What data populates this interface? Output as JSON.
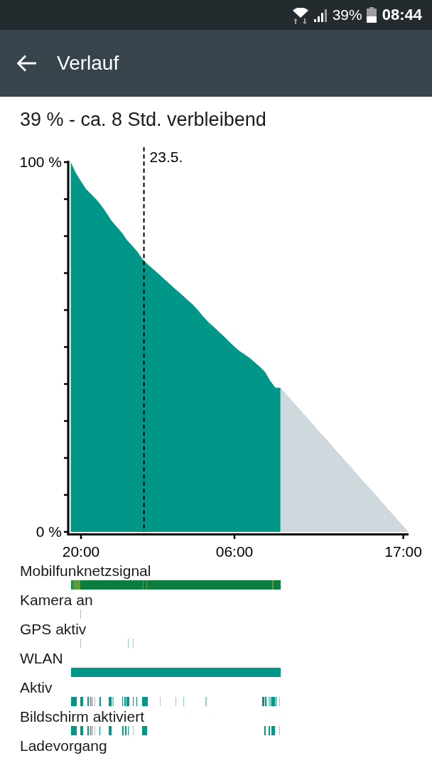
{
  "status_bar": {
    "battery_percent": "39%",
    "time": "08:44"
  },
  "app_bar": {
    "title": "Verlauf"
  },
  "summary": "39 % - ca. 8 Std. verbleibend",
  "battery_chart": {
    "chart_data": {
      "type": "area",
      "categories": [
        null,
        null,
        "20:00",
        null,
        null,
        null,
        null,
        null,
        null,
        null,
        null,
        null,
        null,
        null,
        null,
        null,
        null,
        null,
        null,
        null,
        null,
        null,
        null,
        null,
        null,
        null,
        null,
        null,
        null,
        null,
        null,
        null,
        "06:00",
        null,
        null,
        null,
        null,
        null,
        null,
        null,
        null,
        null,
        null,
        null,
        null,
        null,
        null,
        null,
        null,
        null,
        null,
        null,
        null,
        null,
        null,
        null,
        null,
        null,
        null,
        null,
        null,
        null,
        null,
        null,
        null,
        "17:00",
        null
      ],
      "series": [
        {
          "color": "#009688",
          "values": [
            100,
            97,
            94.8,
            92.7,
            91.3,
            89.9,
            88.2,
            86.2,
            84.1,
            82.5,
            80.9,
            78.9,
            77.4,
            75.8,
            73.8,
            72.4,
            71.2,
            70,
            68.7,
            67.5,
            66.2,
            65,
            63.8,
            62.5,
            61.3,
            59.7,
            58.1,
            56.6,
            55.4,
            54.1,
            52.8,
            51.4,
            50.1,
            48.9,
            48,
            47,
            45.8,
            44.6,
            43.2,
            40.8,
            39,
            39,
            null,
            null,
            null,
            null,
            null,
            null,
            null,
            null,
            null,
            null,
            null,
            null,
            null,
            null,
            null,
            null,
            null,
            null,
            null,
            null,
            null,
            null,
            null,
            null,
            null
          ]
        },
        {
          "color": "#cfd8dc",
          "values": [
            null,
            null,
            null,
            null,
            null,
            null,
            null,
            null,
            null,
            null,
            null,
            null,
            null,
            null,
            null,
            null,
            null,
            null,
            null,
            null,
            null,
            null,
            null,
            null,
            null,
            null,
            null,
            null,
            null,
            null,
            null,
            null,
            null,
            null,
            null,
            null,
            null,
            null,
            null,
            null,
            null,
            39,
            37.4,
            35.9,
            34.3,
            32.8,
            31.2,
            29.6,
            28.1,
            26.5,
            25,
            23.4,
            21.8,
            20.3,
            18.7,
            17.2,
            15.6,
            14,
            12.5,
            10.9,
            9.4,
            7.8,
            6.2,
            4.7,
            3.1,
            1.6,
            0
          ]
        }
      ],
      "ylim": [
        0,
        100
      ],
      "yticks": [
        {
          "value": 0,
          "label": "0 %"
        },
        {
          "value": 100,
          "label": "100 %"
        }
      ],
      "annotations": [
        "23.5."
      ]
    }
  },
  "usage_rows": [
    {
      "label": "Mobilfunknetzsignal",
      "kind": "signal"
    },
    {
      "label": "Kamera an",
      "kind": "events"
    },
    {
      "label": "GPS aktiv",
      "kind": "events"
    },
    {
      "label": "WLAN",
      "kind": "events"
    },
    {
      "label": "Aktiv",
      "kind": "events"
    },
    {
      "label": "Bildschirm aktiviert",
      "kind": "events"
    },
    {
      "label": "Ladevorgang",
      "kind": "events"
    }
  ]
}
